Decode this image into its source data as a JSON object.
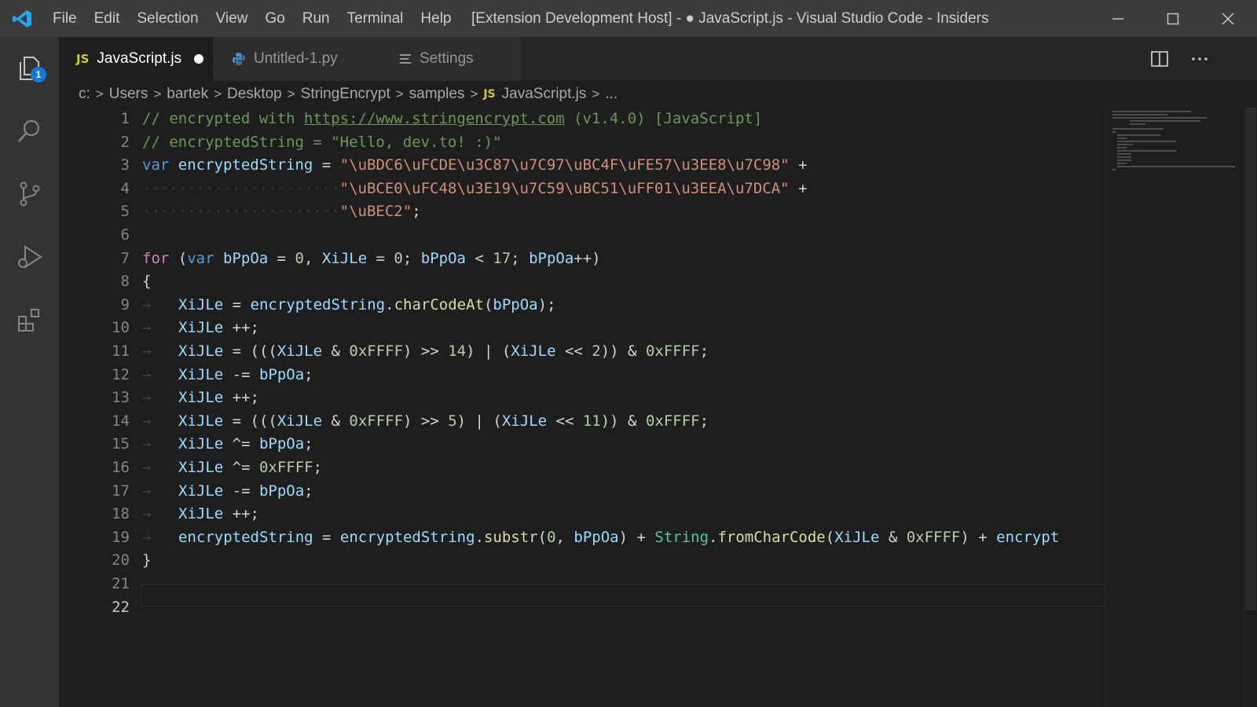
{
  "window": {
    "title": "[Extension Development Host] - ● JavaScript.js - Visual Studio Code - Insiders",
    "accent": "#0e7ad3"
  },
  "menu": [
    "File",
    "Edit",
    "Selection",
    "View",
    "Go",
    "Run",
    "Terminal",
    "Help"
  ],
  "activity": {
    "explorer_badge": "1",
    "items": [
      "files-icon",
      "search-icon",
      "source-control-icon",
      "run-debug-icon",
      "extensions-icon"
    ]
  },
  "tabs": [
    {
      "label": "JavaScript.js",
      "lang": "JS",
      "active": true,
      "dirty": true
    },
    {
      "label": "Untitled-1.py",
      "active": false
    },
    {
      "label": "Settings",
      "active": false
    }
  ],
  "breadcrumbs": {
    "parts": [
      "c:",
      "Users",
      "bartek",
      "Desktop",
      "StringEncrypt",
      "samples"
    ],
    "file_lang": "JS",
    "file": "JavaScript.js",
    "tail": "..."
  },
  "editor": {
    "line_numbers": [
      "1",
      "2",
      "3",
      "4",
      "5",
      "6",
      "7",
      "8",
      "9",
      "10",
      "11",
      "12",
      "13",
      "14",
      "15",
      "16",
      "17",
      "18",
      "19",
      "20",
      "21",
      "22"
    ],
    "active_line": "22",
    "code": {
      "l1": {
        "c1": "// encrypted with ",
        "url": "https://www.stringencrypt.com",
        "c2": " (v1.4.0) [JavaScript]"
      },
      "l2": {
        "c": "// encryptedString = \"Hello, dev.to! :)\""
      },
      "l3": {
        "k": "var",
        "v": "encryptedString",
        "op": "=",
        "s": "\"\\uBDC6\\uFCDE\\u3C87\\u7C97\\uBC4F\\uFE57\\u3EE8\\u7C98\"",
        "plus": "+"
      },
      "l4": {
        "s": "\"\\uBCE0\\uFC48\\u3E19\\u7C59\\uBC51\\uFF01\\u3EEA\\u7DCA\"",
        "plus": "+"
      },
      "l5": {
        "s": "\"\\uBEC2\"",
        "end": ";"
      },
      "l7": {
        "for": "for",
        "open": " (",
        "var": "var",
        "v1": "bPpOa",
        "eq1": " = ",
        "n1": "0",
        "comma": ", ",
        "v2": "XiJLe",
        "eq2": " = ",
        "n2": "0",
        "semi1": "; ",
        "v3": "bPpOa",
        "lt": " < ",
        "n3": "17",
        "semi2": "; ",
        "v4": "bPpOa",
        "inc": "++)"
      },
      "l8": {
        "t": "{"
      },
      "l9": {
        "v": "XiJLe",
        "eq": " = ",
        "v2": "encryptedString",
        "dot": ".",
        "fn": "charCodeAt",
        "open": "(",
        "a": "bPpOa",
        "close": ");"
      },
      "l10": {
        "v": "XiJLe",
        "rest": " ++;"
      },
      "l11": {
        "v": "XiJLe",
        "a": " = (((",
        "v2": "XiJLe",
        "b": " & ",
        "n1": "0xFFFF",
        "c": ") >> ",
        "n2": "14",
        "d": ") | (",
        "v3": "XiJLe",
        "e": " << ",
        "n3": "2",
        "f": ")) & ",
        "n4": "0xFFFF",
        "g": ";"
      },
      "l12": {
        "v": "XiJLe",
        "op": " -= ",
        "v2": "bPpOa",
        "end": ";"
      },
      "l13": {
        "v": "XiJLe",
        "rest": " ++;"
      },
      "l14": {
        "v": "XiJLe",
        "a": " = (((",
        "v2": "XiJLe",
        "b": " & ",
        "n1": "0xFFFF",
        "c": ") >> ",
        "n2": "5",
        "d": ") | (",
        "v3": "XiJLe",
        "e": " << ",
        "n3": "11",
        "f": ")) & ",
        "n4": "0xFFFF",
        "g": ";"
      },
      "l15": {
        "v": "XiJLe",
        "op": " ^= ",
        "v2": "bPpOa",
        "end": ";"
      },
      "l16": {
        "v": "XiJLe",
        "op": " ^= ",
        "n": "0xFFFF",
        "end": ";"
      },
      "l17": {
        "v": "XiJLe",
        "op": " -= ",
        "v2": "bPpOa",
        "end": ";"
      },
      "l18": {
        "v": "XiJLe",
        "rest": " ++;"
      },
      "l19": {
        "v": "encryptedString",
        "eq": " = ",
        "v2": "encryptedString",
        "dot": ".",
        "fn": "substr",
        "a": "(",
        "n1": "0",
        "b": ", ",
        "v3": "bPpOa",
        "c": ") + ",
        "t": "String",
        "dot2": ".",
        "fn2": "fromCharCode",
        "d": "(",
        "v4": "XiJLe",
        "e": " & ",
        "n2": "0xFFFF",
        "f": ") + ",
        "v5": "encrypt"
      },
      "l20": {
        "t": "}"
      }
    }
  }
}
